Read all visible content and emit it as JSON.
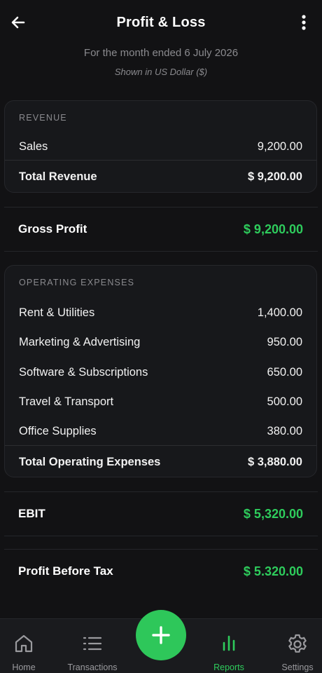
{
  "header": {
    "title": "Profit & Loss",
    "back_icon": "arrow-left-icon",
    "menu_icon": "more-vertical-icon"
  },
  "report": {
    "period": "For the month ended 6 July 2026",
    "currency_note": "Shown in US Dollar ($)"
  },
  "revenue": {
    "section_title": "REVENUE",
    "items": [
      {
        "label": "Sales",
        "value": "9,200.00"
      }
    ],
    "total_label": "Total Revenue",
    "total_value": "$ 9,200.00"
  },
  "gross_profit": {
    "label": "Gross Profit",
    "value": "$ 9,200.00"
  },
  "operating_expenses": {
    "section_title": "OPERATING EXPENSES",
    "items": [
      {
        "label": "Rent & Utilities",
        "value": "1,400.00"
      },
      {
        "label": "Marketing & Advertising",
        "value": "950.00"
      },
      {
        "label": "Software & Subscriptions",
        "value": "650.00"
      },
      {
        "label": "Travel & Transport",
        "value": "500.00"
      },
      {
        "label": "Office Supplies",
        "value": "380.00"
      }
    ],
    "total_label": "Total Operating Expenses",
    "total_value": "$ 3,880.00"
  },
  "ebit": {
    "label": "EBIT",
    "value": "$ 5,320.00"
  },
  "profit_before_tax": {
    "label": "Profit Before Tax",
    "value": "$ 5.320.00"
  },
  "nav": {
    "items": [
      {
        "label": "Home",
        "icon": "home-icon"
      },
      {
        "label": "Transactions",
        "icon": "list-icon"
      },
      {
        "label": "Reports",
        "icon": "bar-chart-icon",
        "active": true
      },
      {
        "label": "Settings",
        "icon": "gear-icon"
      }
    ],
    "fab_icon": "plus-icon"
  },
  "colors": {
    "background": "#121214",
    "card": "#17181b",
    "accent_green": "#2ecc5c",
    "muted_text": "#8a8a8e"
  }
}
